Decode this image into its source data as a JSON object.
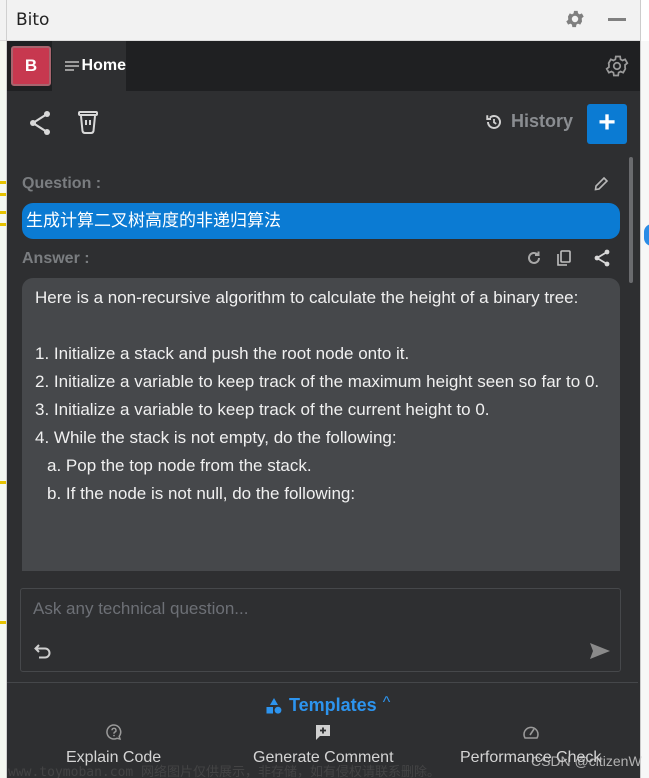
{
  "window": {
    "title": "Bito"
  },
  "header": {
    "logo_letter": "B",
    "home_tab": "Home"
  },
  "toolbar": {
    "history_label": "History",
    "new_chat_label": "+"
  },
  "question": {
    "label": "Question :",
    "text": "生成计算二叉树高度的非递归算法"
  },
  "answer": {
    "label": "Answer :",
    "lines": [
      "Here is a non-recursive algorithm to calculate the height of a binary tree:",
      "",
      "1. Initialize a stack and push the root node onto it.",
      "2. Initialize a variable to keep track of the maximum height seen so far to 0.",
      "3. Initialize a variable to keep track of the current height to 0.",
      "4. While the stack is not empty, do the following:",
      "a. Pop the top node from the stack.",
      "b. If the node is not null, do the following:"
    ]
  },
  "input": {
    "placeholder": "Ask any technical question...",
    "value": ""
  },
  "templates": {
    "toggle_label": "Templates",
    "caret": "^",
    "items": [
      {
        "label": "Explain Code",
        "icon": "question-bubble-icon"
      },
      {
        "label": "Generate Comment",
        "icon": "comment-plus-icon"
      },
      {
        "label": "Performance Check",
        "icon": "gauge-icon"
      }
    ]
  },
  "overlay": {
    "watermark": "www.toymoban.com 网络图片仅供展示，非存储，如有侵权请联系删除。",
    "credit": "CSDN @citizenW"
  },
  "colors": {
    "accent": "#0b7bd3",
    "logo": "#c7384f",
    "templates": "#2d94ee",
    "panel_bg": "#2e2f31",
    "answer_bg": "#46484b"
  }
}
